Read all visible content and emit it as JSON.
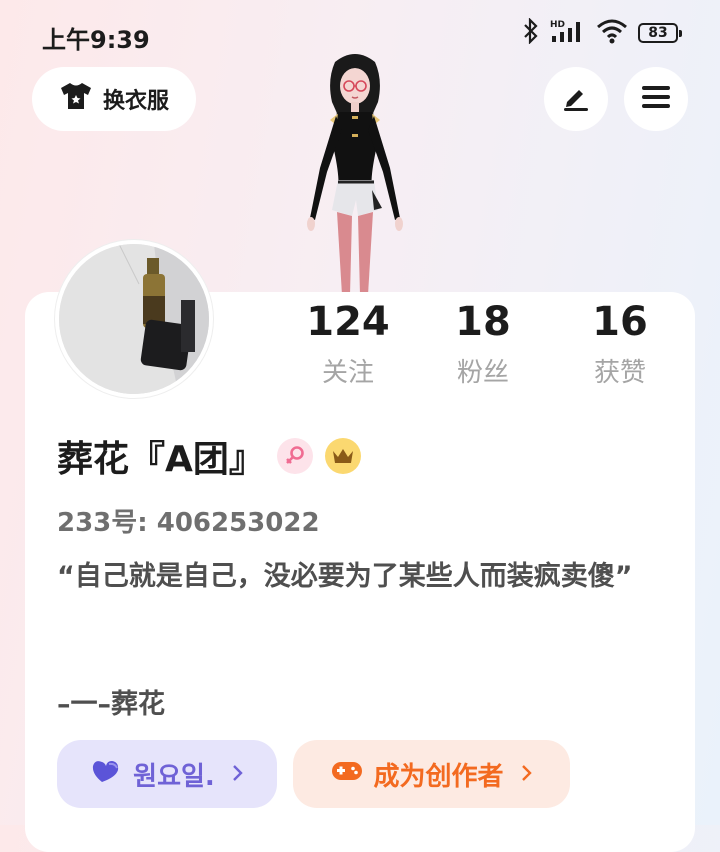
{
  "status_bar": {
    "time": "上午9:39",
    "battery": "83"
  },
  "header": {
    "outfit_label": "换衣服"
  },
  "stats": [
    {
      "value": "124",
      "label": "关注"
    },
    {
      "value": "18",
      "label": "粉丝"
    },
    {
      "value": "16",
      "label": "获赞"
    }
  ],
  "profile": {
    "username": "葬花『A团』",
    "id_text": "233号: 406253022",
    "bio": "“自己就是自己，没必要为了某些人而装疯卖傻”",
    "signature": "–一–葬花"
  },
  "actions": {
    "group_label": "원요일.",
    "creator_label": "成为创作者"
  },
  "colors": {
    "accent_purple": "#6f62d6",
    "accent_orange": "#f36a20"
  },
  "icons": [
    "bluetooth-icon",
    "signal-icon",
    "wifi-icon",
    "battery-icon",
    "shirt-icon",
    "edit-icon",
    "menu-icon",
    "female-icon",
    "crown-icon",
    "heart-icon",
    "gamepad-icon",
    "chevron-right-icon"
  ]
}
